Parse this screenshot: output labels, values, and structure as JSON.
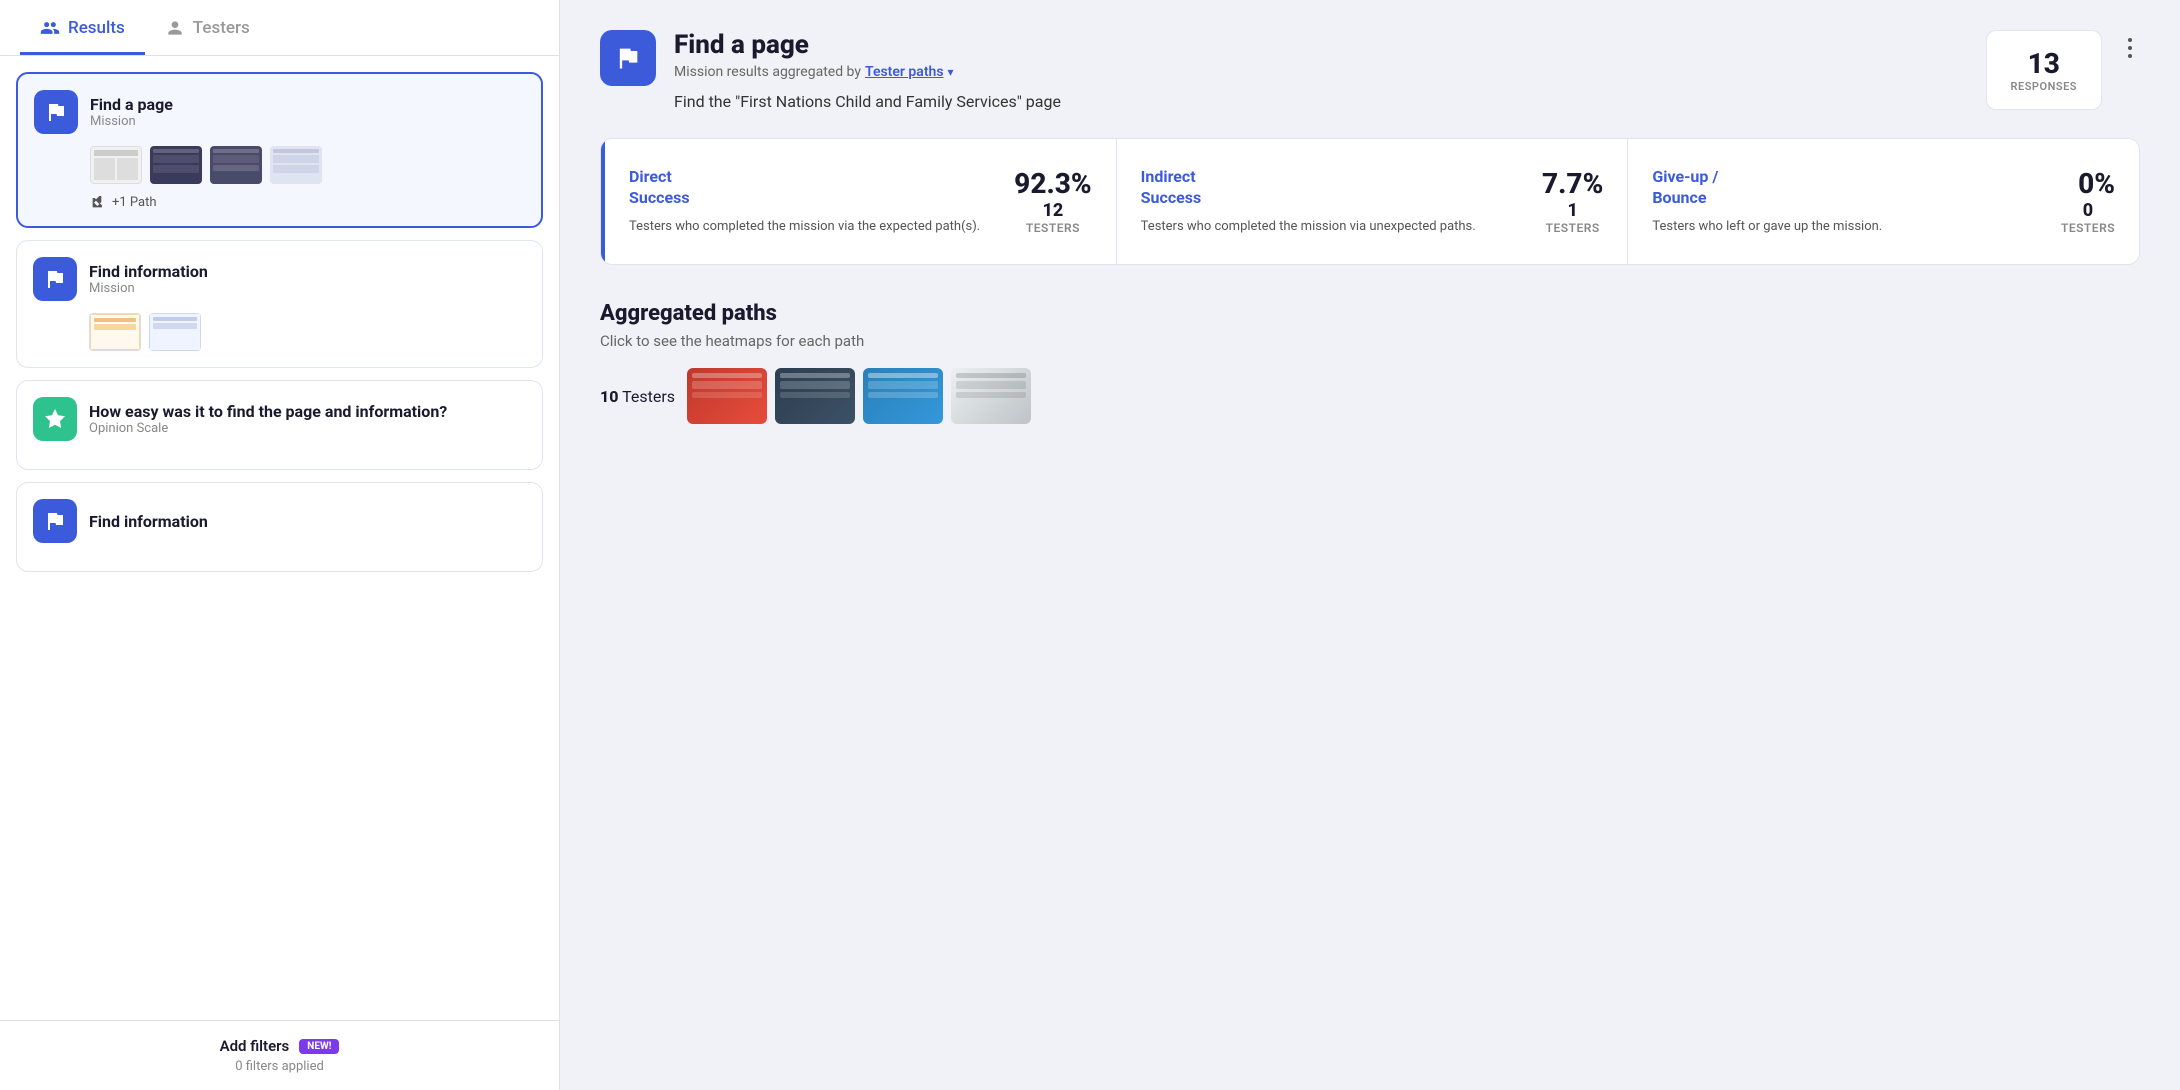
{
  "tabs": [
    {
      "id": "results",
      "label": "Results",
      "active": true
    },
    {
      "id": "testers",
      "label": "Testers",
      "active": false
    }
  ],
  "missions": [
    {
      "id": "find-a-page",
      "title": "Find a page",
      "type": "Mission",
      "active": true,
      "has_thumbnails": true,
      "path_tag": "+1 Path"
    },
    {
      "id": "find-information",
      "title": "Find information",
      "type": "Mission",
      "active": false,
      "has_thumbnails": true,
      "path_tag": null
    },
    {
      "id": "how-easy",
      "title": "How easy was it to find the page and information?",
      "type": "Opinion Scale",
      "active": false,
      "icon_type": "green",
      "has_thumbnails": false,
      "path_tag": null
    },
    {
      "id": "find-information-2",
      "title": "Find information",
      "type": "Mission",
      "active": false,
      "has_thumbnails": false,
      "path_tag": null
    }
  ],
  "bottom_bar": {
    "add_filters_label": "Add filters",
    "new_badge": "NEW!",
    "filters_applied_label": "0 filters applied"
  },
  "detail": {
    "title": "Find a page",
    "aggregated_by_prefix": "Mission results aggregated by",
    "aggregated_by_link": "Tester paths",
    "description": "Find the \"First Nations Child and Family Services\" page",
    "responses_count": "13",
    "responses_label": "RESPONSES"
  },
  "stats": [
    {
      "id": "direct-success",
      "category": "Direct\nSuccess",
      "description": "Testers who completed the mission via the expected path(s).",
      "percentage": "92.3%",
      "count": "12",
      "testers_label": "TESTERS",
      "active_border": true
    },
    {
      "id": "indirect-success",
      "category": "Indirect\nSuccess",
      "description": "Testers who completed the mission via unexpected paths.",
      "percentage": "7.7%",
      "count": "1",
      "testers_label": "TESTERS",
      "active_border": false
    },
    {
      "id": "give-up-bounce",
      "category": "Give-up /\nBounce",
      "description": "Testers who left or gave up the mission.",
      "percentage": "0%",
      "count": "0",
      "testers_label": "TESTERS",
      "active_border": false
    }
  ],
  "aggregated_paths": {
    "title": "Aggregated paths",
    "subtitle": "Click to see the heatmaps for each path",
    "testers_prefix": "10",
    "testers_label": "Testers"
  }
}
